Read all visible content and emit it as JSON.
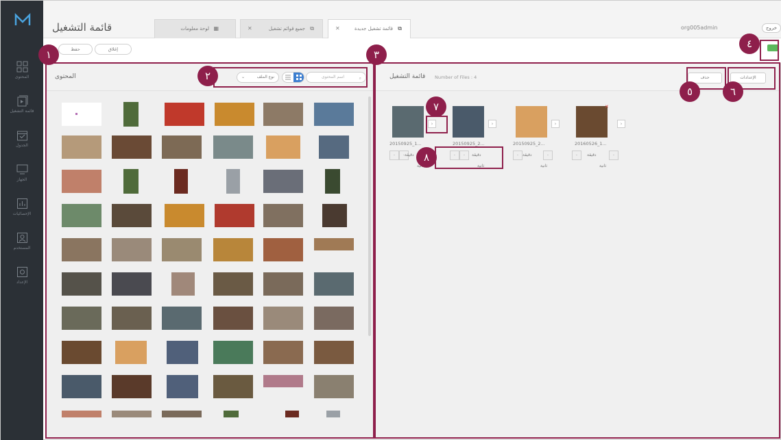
{
  "header": {
    "page_title": "قائمة التشغيل",
    "tabs": [
      {
        "label": "لوحة معلومات",
        "active": false
      },
      {
        "label": "جميع قوائم تشغيل",
        "active": false
      },
      {
        "label": "قائمة تشغيل جديدة",
        "active": true
      }
    ],
    "user": "org005admin",
    "logout": "خروج"
  },
  "sidebar": {
    "items": [
      {
        "label": "المحتوى",
        "icon": "grid-icon"
      },
      {
        "label": "قائمة التشغيل",
        "icon": "playlist-icon"
      },
      {
        "label": "الجدول",
        "icon": "calendar-icon"
      },
      {
        "label": "الجهاز",
        "icon": "monitor-icon"
      },
      {
        "label": "الإحصائيات",
        "icon": "chart-icon"
      },
      {
        "label": "المستخدم",
        "icon": "user-icon"
      },
      {
        "label": "الإعداد",
        "icon": "settings-icon"
      }
    ]
  },
  "toolbar": {
    "close_label": "إغلاق",
    "save_label": "حفظ"
  },
  "content": {
    "title": "المحتوى",
    "search_placeholder": "اسم المحتوى",
    "type_select": "نوع الملف"
  },
  "playlist": {
    "title": "قائمة التشغيل",
    "count_text": "Number of Files : 4",
    "delete_label": "حذف",
    "settings_label": "الإعدادات",
    "items": [
      {
        "name": "20150925_1...",
        "minute_label": "دقيقة",
        "second_label": "ثانية"
      },
      {
        "name": "20150925_2...",
        "minute_label": "دقيقة",
        "second_label": "ثانية"
      },
      {
        "name": "20150925_2...",
        "minute_label": "دقيقة",
        "second_label": "ثانية"
      },
      {
        "name": "20160526_1...",
        "minute_label": "دقيقة",
        "second_label": "ثانية"
      }
    ]
  },
  "badges": {
    "b1": "١",
    "b2": "٢",
    "b3": "٣",
    "b4": "٤",
    "b5": "٥",
    "b6": "٦",
    "b7": "٧",
    "b8": "٨"
  },
  "colors": {
    "sidebar": "#2b3036",
    "annotation": "#8e1f4b",
    "status_green": "#5cb85c"
  }
}
